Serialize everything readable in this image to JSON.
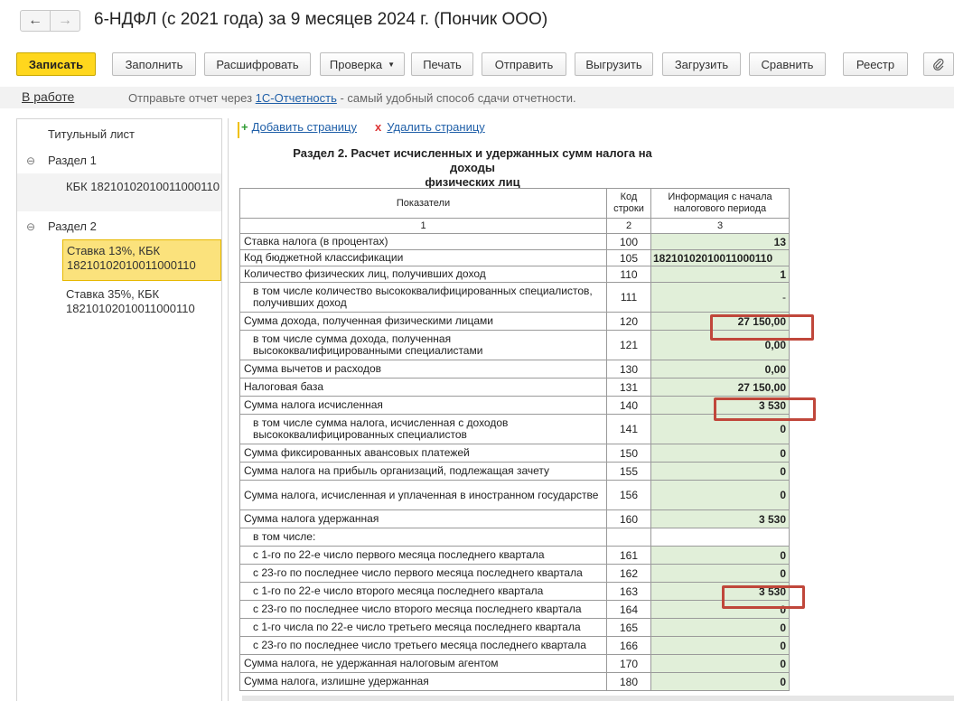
{
  "window": {
    "title": "6-НДФЛ (с 2021 года) за 9 месяцев 2024 г. (Пончик ООО)",
    "back_icon": "←",
    "forward_icon": "→"
  },
  "toolbar": {
    "save": "Записать",
    "fill": "Заполнить",
    "decode": "Расшифровать",
    "check": "Проверка",
    "print": "Печать",
    "send": "Отправить",
    "export": "Выгрузить",
    "import": "Загрузить",
    "compare": "Сравнить",
    "registry": "Реестр",
    "attach_icon": "paperclip-icon"
  },
  "status": {
    "state": "В работе",
    "msg_before": "Отправьте отчет через ",
    "msg_link": "1С-Отчетность",
    "msg_after": " - самый удобный способ сдачи отчетности."
  },
  "tree": {
    "title_page": "Титульный лист",
    "section1": "Раздел 1",
    "section1_kbk": "КБК 18210102010011000110",
    "section2": "Раздел 2",
    "rate13_line1": "Ставка 13%, КБК",
    "rate13_line2": "18210102010011000110",
    "rate35_line1": "Ставка 35%, КБК",
    "rate35_line2": "18210102010011000110"
  },
  "content": {
    "add_page": "Добавить страницу",
    "delete_page": "Удалить страницу",
    "section_title_line1": "Раздел 2. Расчет исчисленных и удержанных сумм налога на доходы",
    "section_title_line2": "физических лиц",
    "headers": {
      "name": "Показатели",
      "code_line1": "Код",
      "code_line2": "строки",
      "value_line1": "Информация с начала",
      "value_line2": "налогового периода",
      "num1": "1",
      "num2": "2",
      "num3": "3"
    },
    "rows": [
      {
        "name": "Ставка налога (в процентах)",
        "code": "100",
        "value": "13"
      },
      {
        "name": "Код бюджетной классификации",
        "code": "105",
        "value": "18210102010011000110"
      },
      {
        "name": "Количество физических лиц, получивших доход",
        "code": "110",
        "value": "1"
      },
      {
        "name": "в том числе количество высококвалифицированных специалистов, получивших доход",
        "code": "111",
        "value": "-"
      },
      {
        "name": "Сумма дохода, полученная физическими лицами",
        "code": "120",
        "value": "27 150,00"
      },
      {
        "name": "в том числе сумма дохода, полученная высококвалифицированными специалистами",
        "code": "121",
        "value": "0,00"
      },
      {
        "name": "Сумма вычетов и расходов",
        "code": "130",
        "value": "0,00"
      },
      {
        "name": "Налоговая база",
        "code": "131",
        "value": "27 150,00"
      },
      {
        "name": "Сумма налога исчисленная",
        "code": "140",
        "value": "3 530"
      },
      {
        "name": "в том числе сумма налога, исчисленная с доходов высококвалифицированных специалистов",
        "code": "141",
        "value": "0"
      },
      {
        "name": "Сумма фиксированных авансовых платежей",
        "code": "150",
        "value": "0"
      },
      {
        "name": "Сумма налога на прибыль организаций, подлежащая зачету",
        "code": "155",
        "value": "0"
      },
      {
        "name": "Сумма налога, исчисленная и уплаченная в иностранном государстве",
        "code": "156",
        "value": "0"
      },
      {
        "name": "Сумма налога удержанная",
        "code": "160",
        "value": "3 530"
      },
      {
        "name": "в том числе:",
        "code": "",
        "value": ""
      },
      {
        "name": "с 1-го по 22-е число первого месяца последнего квартала",
        "code": "161",
        "value": "0"
      },
      {
        "name": "с 23-го по последнее число первого месяца последнего квартала",
        "code": "162",
        "value": "0"
      },
      {
        "name": "с 1-го по 22-е число второго месяца последнего квартала",
        "code": "163",
        "value": "3 530"
      },
      {
        "name": "с 23-го по последнее число второго месяца последнего квартала",
        "code": "164",
        "value": "0"
      },
      {
        "name": "с 1-го числа по 22-е число третьего месяца последнего квартала",
        "code": "165",
        "value": "0"
      },
      {
        "name": "с 23-го по последнее число третьего месяца последнего квартала",
        "code": "166",
        "value": "0"
      },
      {
        "name": "Сумма налога, не удержанная налоговым агентом",
        "code": "170",
        "value": "0"
      },
      {
        "name": "Сумма налога, излишне удержанная",
        "code": "180",
        "value": "0"
      }
    ]
  }
}
